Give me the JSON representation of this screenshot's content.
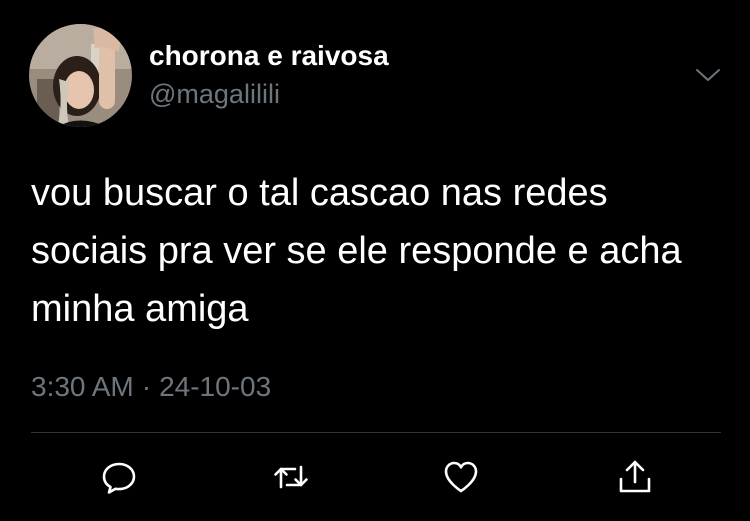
{
  "tweet": {
    "display_name": "chorona e raivosa",
    "handle": "@magalilili",
    "text": "vou buscar o tal cascao nas redes sociais pra ver se ele responde e acha minha amiga",
    "time": "3:30 AM",
    "separator": "·",
    "date": "24-10-03"
  },
  "icons": {
    "menu": "chevron-down-icon",
    "reply": "reply-icon",
    "retweet": "retweet-icon",
    "like": "heart-icon",
    "share": "share-icon"
  },
  "colors": {
    "background": "#000000",
    "text_primary": "#ffffff",
    "text_secondary": "#6e767d",
    "divider": "#2f3336"
  }
}
